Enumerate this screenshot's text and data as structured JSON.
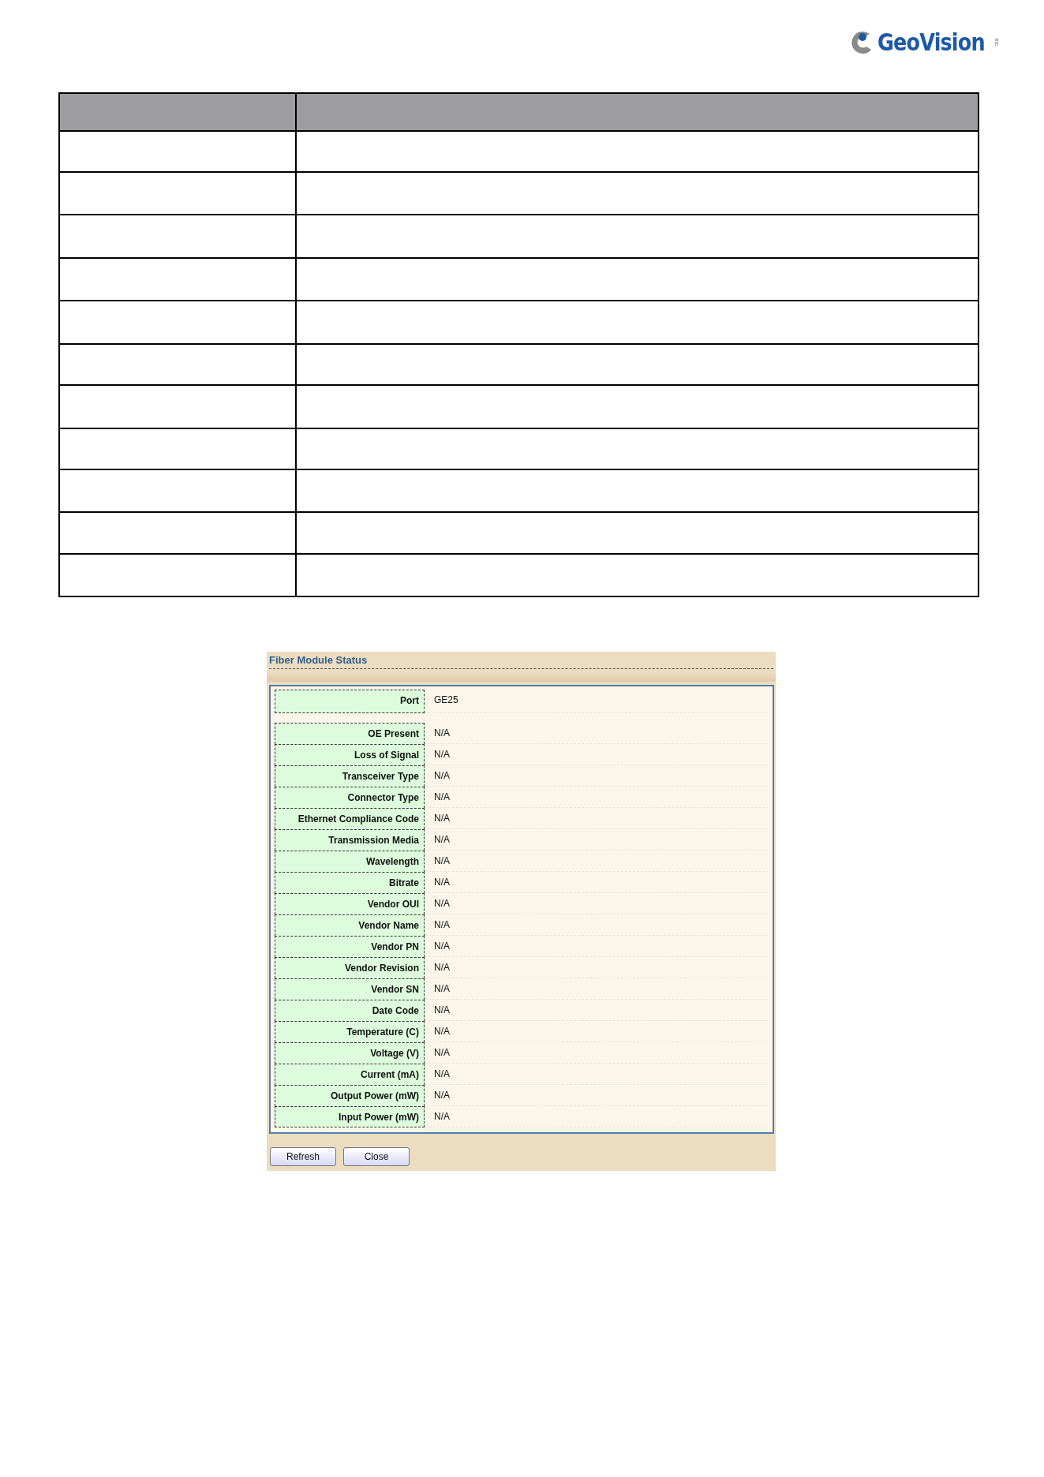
{
  "logo": {
    "name": "GeoVision",
    "suffix": "inc"
  },
  "dialog": {
    "title": "Fiber Module Status",
    "port": {
      "label": "Port",
      "value": "GE25"
    },
    "fields": [
      {
        "label": "OE Present",
        "value": "N/A"
      },
      {
        "label": "Loss of Signal",
        "value": "N/A"
      },
      {
        "label": "Transceiver Type",
        "value": "N/A"
      },
      {
        "label": "Connector Type",
        "value": "N/A"
      },
      {
        "label": "Ethernet Compliance Code",
        "value": "N/A"
      },
      {
        "label": "Transmission Media",
        "value": "N/A"
      },
      {
        "label": "Wavelength",
        "value": "N/A"
      },
      {
        "label": "Bitrate",
        "value": "N/A"
      },
      {
        "label": "Vendor OUI",
        "value": "N/A"
      },
      {
        "label": "Vendor Name",
        "value": "N/A"
      },
      {
        "label": "Vendor PN",
        "value": "N/A"
      },
      {
        "label": "Vendor Revision",
        "value": "N/A"
      },
      {
        "label": "Vendor SN",
        "value": "N/A"
      },
      {
        "label": "Date Code",
        "value": "N/A"
      },
      {
        "label": "Temperature (C)",
        "value": "N/A"
      },
      {
        "label": "Voltage (V)",
        "value": "N/A"
      },
      {
        "label": "Current (mA)",
        "value": "N/A"
      },
      {
        "label": "Output Power (mW)",
        "value": "N/A"
      },
      {
        "label": "Input Power (mW)",
        "value": "N/A"
      }
    ],
    "buttons": [
      "Refresh",
      "Close"
    ]
  }
}
